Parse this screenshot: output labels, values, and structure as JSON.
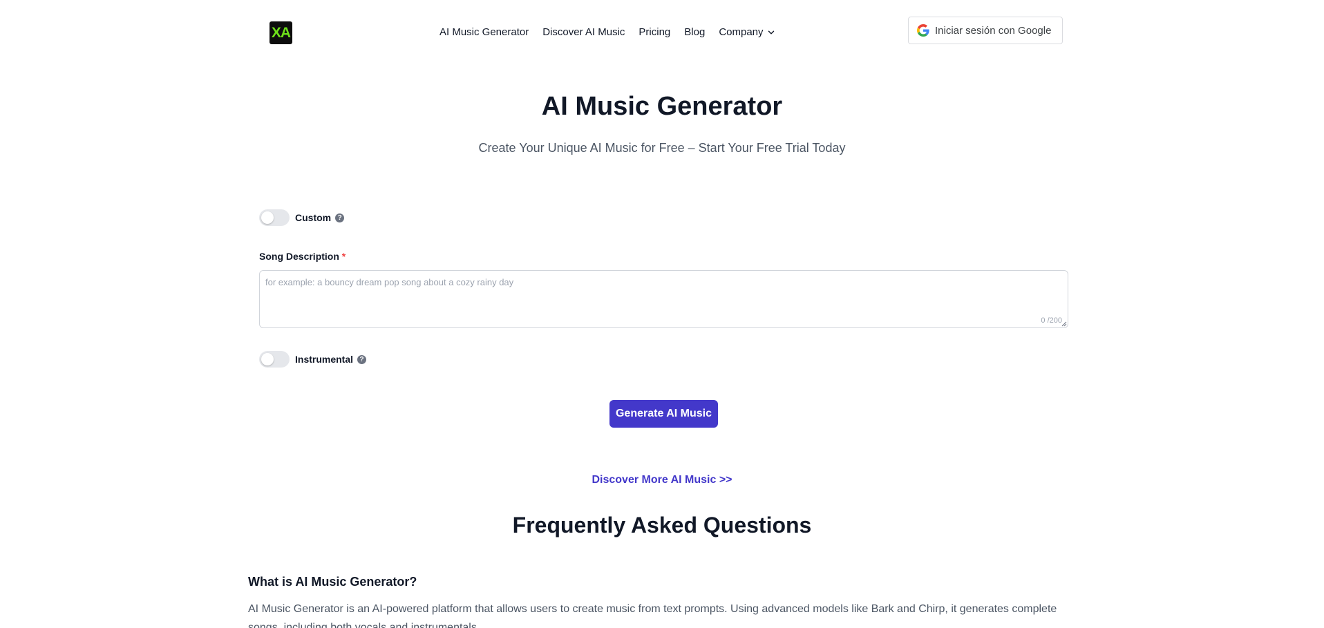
{
  "header": {
    "logo_text": "XA",
    "nav": [
      {
        "label": "AI Music Generator"
      },
      {
        "label": "Discover AI Music"
      },
      {
        "label": "Pricing"
      },
      {
        "label": "Blog"
      },
      {
        "label": "Company"
      }
    ],
    "signin_label": "Iniciar sesión con Google"
  },
  "hero": {
    "title": "AI Music Generator",
    "subtitle": "Create Your Unique AI Music for Free – Start Your Free Trial Today"
  },
  "form": {
    "custom_label": "Custom",
    "custom_enabled": false,
    "description_label": "Song Description",
    "required_mark": "*",
    "description_placeholder": "for example: a bouncy dream pop song about a cozy rainy day",
    "description_value": "",
    "char_counter": "0 /200",
    "instrumental_label": "Instrumental",
    "instrumental_enabled": false,
    "generate_label": "Generate AI Music"
  },
  "discover_more_label": "Discover More AI Music >>",
  "faq": {
    "title": "Frequently Asked Questions",
    "items": [
      {
        "question": "What is AI Music Generator?",
        "answer": "AI Music Generator is an AI-powered platform that allows users to create music from text prompts. Using advanced models like Bark and Chirp, it generates complete songs, including both vocals and instrumentals."
      }
    ]
  },
  "colors": {
    "accent": "#4338ca",
    "logo_green": "#6ee01a",
    "required": "#ef4444"
  }
}
